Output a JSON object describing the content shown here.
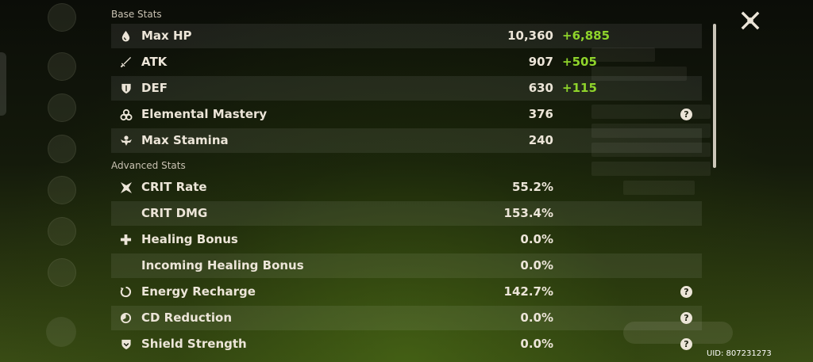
{
  "sections": {
    "base_title": "Base Stats",
    "advanced_title": "Advanced Stats"
  },
  "base_stats": [
    {
      "icon": "water-drop-icon",
      "label": "Max HP",
      "value": "10,360",
      "bonus": "+6,885",
      "help": false
    },
    {
      "icon": "sword-icon",
      "label": "ATK",
      "value": "907",
      "bonus": "+505",
      "help": false
    },
    {
      "icon": "shield-icon",
      "label": "DEF",
      "value": "630",
      "bonus": "+115",
      "help": false
    },
    {
      "icon": "elemental-mastery-icon",
      "label": "Elemental Mastery",
      "value": "376",
      "bonus": "",
      "help": true
    },
    {
      "icon": "stamina-icon",
      "label": "Max Stamina",
      "value": "240",
      "bonus": "",
      "help": false
    }
  ],
  "advanced_stats": [
    {
      "icon": "crit-rate-icon",
      "label": "CRIT Rate",
      "value": "55.2%",
      "help": false
    },
    {
      "icon": "",
      "label": "CRIT DMG",
      "value": "153.4%",
      "help": false
    },
    {
      "icon": "healing-cross-icon",
      "label": "Healing Bonus",
      "value": "0.0%",
      "help": false
    },
    {
      "icon": "",
      "label": "Incoming Healing Bonus",
      "value": "0.0%",
      "help": false
    },
    {
      "icon": "energy-recharge-icon",
      "label": "Energy Recharge",
      "value": "142.7%",
      "help": true
    },
    {
      "icon": "cd-reduction-icon",
      "label": "CD Reduction",
      "value": "0.0%",
      "help": true
    },
    {
      "icon": "shield-strength-icon",
      "label": "Shield Strength",
      "value": "0.0%",
      "help": true
    }
  ],
  "help_glyph": "?",
  "uid": "UID: 807231273",
  "colors": {
    "text": "#ece5d8",
    "bonus": "#8fd42b",
    "row_shade": "rgba(255,255,255,0.075)"
  }
}
